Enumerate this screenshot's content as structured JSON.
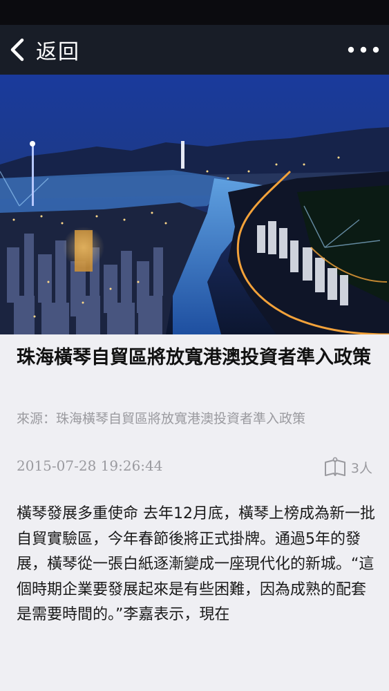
{
  "nav": {
    "back_label": "返回",
    "back_icon": "chevron-left-icon",
    "more_icon": "more-horizontal-icon",
    "background": "#181d27"
  },
  "hero_image": {
    "description_icon": "city-skyline-photo"
  },
  "article": {
    "title": "珠海橫琴自貿區將放寬港澳投資者準入政策",
    "source": "來源：珠海橫琴自貿區將放寬港澳投資者準入政策",
    "timestamp": "2015-07-28 19:26:44",
    "readers_icon": "book-reader-icon",
    "readers_count": "3人",
    "body": "橫琴發展多重使命 去年12月底，橫琴上榜成為新一批自貿實驗區，今年春節後將正式掛牌。通過5年的發展，橫琴從一張白紙逐漸變成一座現代化的新城。“這個時期企業要發展起來是有些困難，因為成熟的配套是需要時間的。”李嘉表示，現在"
  }
}
